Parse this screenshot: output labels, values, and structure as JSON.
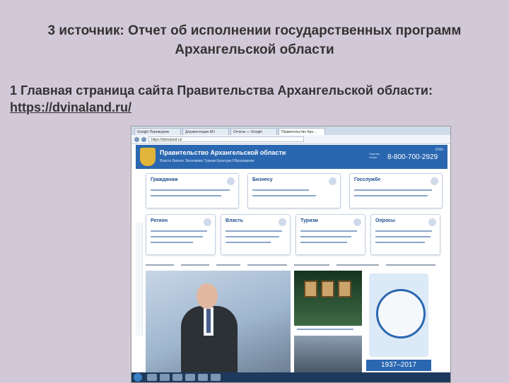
{
  "slide": {
    "title": "3 источник: Отчет об исполнении государственных программ Архангельской области",
    "body_prefix": "1 Главная страница сайта Правительства Архангельской области: ",
    "body_link": "https://dvinaland.ru/"
  },
  "browser": {
    "tabs": [
      "Google Переводчик",
      "Документация АО",
      "Отчеты — Google",
      "Правительство Арх…"
    ],
    "address": "https://dvinaland.ru/"
  },
  "site": {
    "org_name": "Правительство Архангельской области",
    "menu": "Власть   Бизнес   Экономика   Туризм   Культура   Образование",
    "hotline_label": "Горячая линия",
    "phone": "8-800-700-2929",
    "lang": "ENG",
    "cards": [
      {
        "title": "Гражданам"
      },
      {
        "title": "Бизнесу"
      },
      {
        "title": "Госслужбе"
      },
      {
        "title": "Регион"
      },
      {
        "title": "Власть"
      },
      {
        "title": "Туризм"
      },
      {
        "title": "Опросы"
      }
    ],
    "anniversary_years": "1937–2017"
  },
  "colors": {
    "slide_bg": "#d2c9d8",
    "site_blue": "#2a67b0",
    "card_title": "#1d4f8f"
  }
}
